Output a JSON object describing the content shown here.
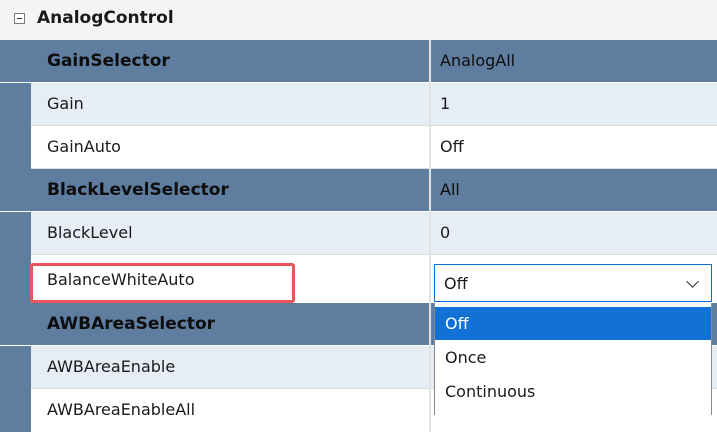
{
  "category": {
    "label": "AnalogControl",
    "collapse_icon": "minus-box-icon"
  },
  "rows": [
    {
      "name": "GainSelector",
      "value": "AnalogAll",
      "style": "selector"
    },
    {
      "name": "Gain",
      "value": "1",
      "style": "alt"
    },
    {
      "name": "GainAuto",
      "value": "Off",
      "style": "plain"
    },
    {
      "name": "BlackLevelSelector",
      "value": "All",
      "style": "selector"
    },
    {
      "name": "BlackLevel",
      "value": "0",
      "style": "alt"
    },
    {
      "name": "BalanceWhiteAuto",
      "value": "Off",
      "style": "editing"
    },
    {
      "name": "AWBAreaSelector",
      "value": "",
      "style": "selector"
    },
    {
      "name": "AWBAreaEnable",
      "value": "",
      "style": "alt"
    },
    {
      "name": "AWBAreaEnableAll",
      "value": "",
      "style": "plain"
    }
  ],
  "combo": {
    "value": "Off",
    "arrow_icon": "chevron-down-icon"
  },
  "dropdown": {
    "options": [
      "Off",
      "Once",
      "Continuous"
    ],
    "selected": "Off"
  },
  "colors": {
    "selector_row": "#5e7d9f",
    "alt_row": "#e6edf5",
    "highlight_outline": "#e8565a",
    "dropdown_selected": "#1271d4"
  }
}
